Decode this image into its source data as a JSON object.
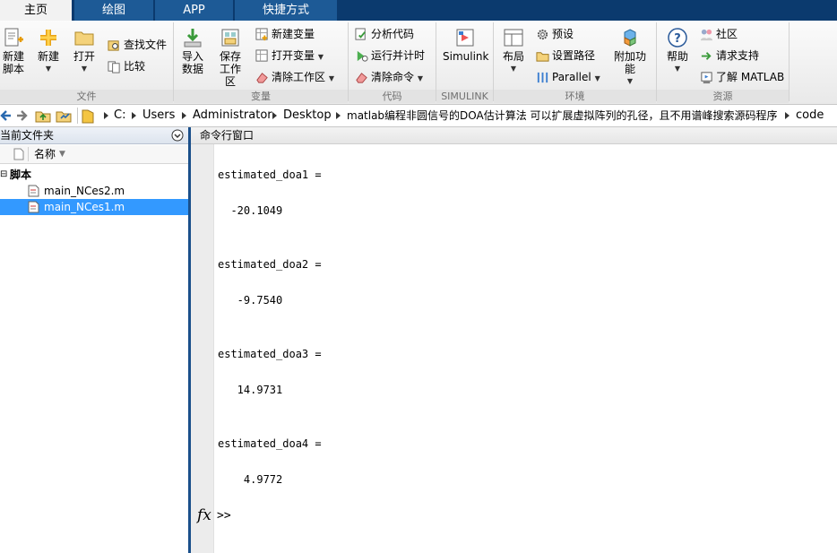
{
  "tabs": [
    {
      "label": "主页",
      "active": true
    },
    {
      "label": "绘图",
      "active": false
    },
    {
      "label": "APP",
      "active": false
    },
    {
      "label": "快捷方式",
      "active": false
    }
  ],
  "ribbon": {
    "file": {
      "group_label": "文件",
      "new_script": {
        "line1": "新建",
        "line2": "脚本"
      },
      "new": "新建",
      "open": "打开",
      "find_files": "查找文件",
      "compare": "比较"
    },
    "variable": {
      "group_label": "变量",
      "import": {
        "line1": "导入",
        "line2": "数据"
      },
      "save_workspace": {
        "line1": "保存",
        "line2": "工作区"
      },
      "new_variable": "新建变量",
      "open_variable": "打开变量",
      "clear_workspace": "清除工作区"
    },
    "code": {
      "group_label": "代码",
      "analyze_code": "分析代码",
      "run_and_time": "运行并计时",
      "clear_commands": "清除命令"
    },
    "simulink": {
      "group_label": "SIMULINK",
      "simulink": "Simulink"
    },
    "environment": {
      "group_label": "环境",
      "layout": "布局",
      "preferences": "预设",
      "set_path": "设置路径",
      "parallel": "Parallel",
      "addons": "附加功能"
    },
    "resources": {
      "group_label": "资源",
      "help": "帮助",
      "community": "社区",
      "request_support": "请求支持",
      "learn_matlab": "了解 MATLAB"
    }
  },
  "address_bar": {
    "crumbs": [
      "C:",
      "Users",
      "Administrator",
      "Desktop",
      "matlab编程非圆信号的DOA估计算法 可以扩展虚拟阵列的孔径，且不用谱峰搜索源码程序",
      "code"
    ]
  },
  "current_folder": {
    "title": "当前文件夹",
    "column_name": "名称",
    "section": "脚本",
    "files": [
      "main_NCes2.m",
      "main_NCes1.m"
    ],
    "selected_index": 1
  },
  "command_window": {
    "title": "命令行窗口",
    "outputs": [
      {
        "name": "estimated_doa1 =",
        "value": "  -20.1049"
      },
      {
        "name": "estimated_doa2 =",
        "value": "   -9.7540"
      },
      {
        "name": "estimated_doa3 =",
        "value": "   14.9731"
      },
      {
        "name": "estimated_doa4 =",
        "value": "    4.9772"
      }
    ],
    "fx_label": "fx",
    "prompt": ">>"
  },
  "colors": {
    "tab_strip": "#0b3a6e",
    "tab": "#1d5a96",
    "selection": "#3399ff",
    "splitter": "#1a4f8a"
  }
}
